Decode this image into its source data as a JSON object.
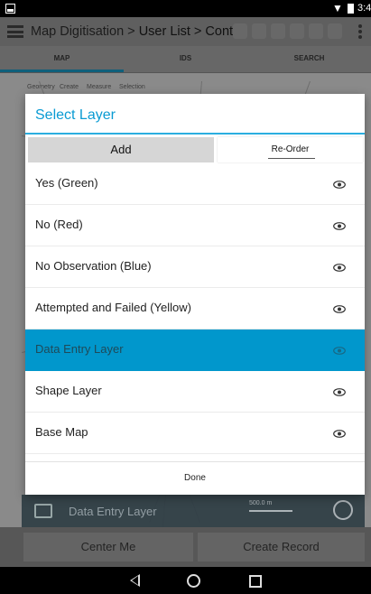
{
  "status_bar": {
    "time": "3:4"
  },
  "app_bar": {
    "title_prefix": "Map Digitisation > ",
    "title_suffix": "User List > Control"
  },
  "tabs": [
    {
      "label": "MAP"
    },
    {
      "label": "IDS"
    },
    {
      "label": "SEARCH"
    }
  ],
  "map": {
    "toolbar": [
      "Geometry",
      "Create",
      "Measure",
      "Selection"
    ],
    "layer_label": "Data Entry Layer",
    "scale": "500.0 m"
  },
  "bottom_buttons": {
    "center_me": "Center Me",
    "create_record": "Create Record"
  },
  "dialog": {
    "title": "Select Layer",
    "add_label": "Add",
    "reorder_label": "Re-Order",
    "layers": [
      {
        "label": "Yes (Green)"
      },
      {
        "label": "No (Red)"
      },
      {
        "label": "No Observation (Blue)"
      },
      {
        "label": "Attempted and Failed (Yellow)"
      },
      {
        "label": "Data Entry Layer",
        "selected": true
      },
      {
        "label": "Shape Layer"
      },
      {
        "label": "Base Map"
      }
    ],
    "done_label": "Done"
  },
  "colors": {
    "accent": "#0a9bd3",
    "selected_row": "#0197cc",
    "appbar_dimmed": "#5f5f5f"
  },
  "icons": {
    "layer_visibility": "eye-icon",
    "menu": "hamburger-menu-icon",
    "overflow": "overflow-menu-icon"
  }
}
